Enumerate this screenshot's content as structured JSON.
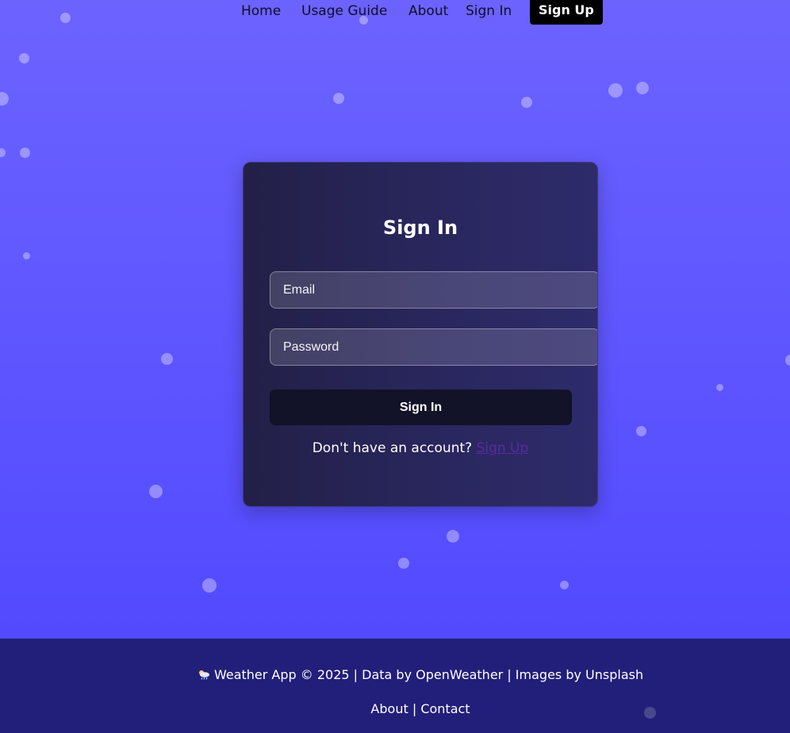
{
  "nav": {
    "home": "Home",
    "usage_guide": "Usage Guide",
    "about": "About",
    "sign_in": "Sign In",
    "sign_up": "Sign Up"
  },
  "form": {
    "title": "Sign In",
    "email_placeholder": "Email",
    "password_placeholder": "Password",
    "submit_label": "Sign In",
    "switch_prompt": "Don't have an account?",
    "switch_link": "Sign Up"
  },
  "footer": {
    "icon": "cloud-sun-rain-icon",
    "credit": "Weather App © 2025 | Data by OpenWeather | Images by Unsplash",
    "about": "About",
    "separator": "|",
    "contact": "Contact"
  },
  "colors": {
    "background_top": "#6c63ff",
    "background_bottom": "#4f46ff",
    "card": "#2a2760",
    "button": "#121228",
    "footer": "#221f7a",
    "link": "#5a2aa0"
  }
}
